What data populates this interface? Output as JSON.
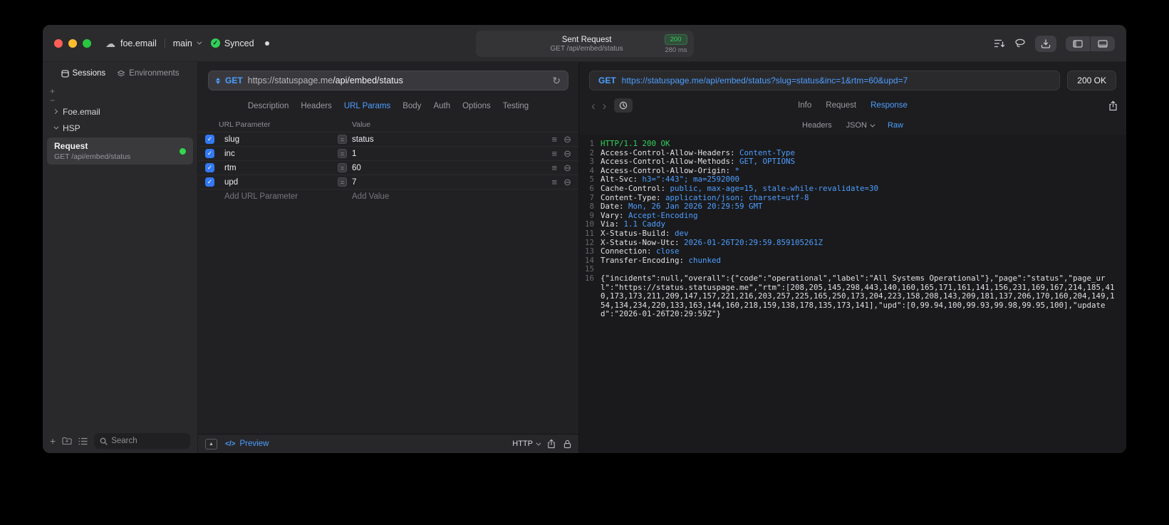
{
  "colors": {
    "accent_blue": "#4d9eff",
    "success_green": "#30d158",
    "checkbox_blue": "#3279f2"
  },
  "titlebar": {
    "project": "foe.email",
    "branch": "main",
    "synced": "Synced",
    "request_summary": {
      "title": "Sent Request",
      "status_code": "200",
      "method_path": "GET /api/embed/status",
      "duration": "280 ms"
    }
  },
  "sidebar": {
    "tabs": [
      {
        "label": "Sessions"
      },
      {
        "label": "Environments"
      }
    ],
    "groups": [
      {
        "label": "Foe.email"
      },
      {
        "label": "HSP"
      }
    ],
    "request_item": {
      "title": "Request",
      "subtitle": "GET /api/embed/status"
    },
    "search_placeholder": "Search"
  },
  "request_pane": {
    "method": "GET",
    "url_host": "https://statuspage.me",
    "url_path": "/api/embed/status",
    "tabs": [
      "Description",
      "Headers",
      "URL Params",
      "Body",
      "Auth",
      "Options",
      "Testing"
    ],
    "active_tab": "URL Params",
    "table": {
      "col_name": "URL Parameter",
      "col_value": "Value",
      "rows": [
        {
          "name": "slug",
          "value": "status",
          "enabled": true
        },
        {
          "name": "inc",
          "value": "1",
          "enabled": true
        },
        {
          "name": "rtm",
          "value": "60",
          "enabled": true
        },
        {
          "name": "upd",
          "value": "7",
          "enabled": true
        }
      ],
      "add_name": "Add URL Parameter",
      "add_value": "Add Value"
    },
    "footer": {
      "preview": "Preview",
      "protocol": "HTTP"
    }
  },
  "response_pane": {
    "method": "GET",
    "url": "https://statuspage.me/api/embed/status?slug=status&inc=1&rtm=60&upd=7",
    "status": "200 OK",
    "tabs": [
      "Info",
      "Request",
      "Response"
    ],
    "active_tab": "Response",
    "subtabs": [
      {
        "label": "Headers"
      },
      {
        "label": "JSON",
        "dropdown": true
      },
      {
        "label": "Raw"
      }
    ],
    "active_subtab": "Raw",
    "lines": [
      {
        "n": "1",
        "segs": [
          {
            "t": "HTTP/1.1 200 OK",
            "c": "g"
          }
        ]
      },
      {
        "n": "2",
        "segs": [
          {
            "t": "Access-Control-Allow-Headers: ",
            "c": "h"
          },
          {
            "t": "Content-Type",
            "c": "v"
          }
        ]
      },
      {
        "n": "3",
        "segs": [
          {
            "t": "Access-Control-Allow-Methods: ",
            "c": "h"
          },
          {
            "t": "GET, OPTIONS",
            "c": "v"
          }
        ]
      },
      {
        "n": "4",
        "segs": [
          {
            "t": "Access-Control-Allow-Origin: ",
            "c": "h"
          },
          {
            "t": "*",
            "c": "v"
          }
        ]
      },
      {
        "n": "5",
        "segs": [
          {
            "t": "Alt-Svc: ",
            "c": "h"
          },
          {
            "t": "h3=\":443\"; ma=2592000",
            "c": "v"
          }
        ]
      },
      {
        "n": "6",
        "segs": [
          {
            "t": "Cache-Control: ",
            "c": "h"
          },
          {
            "t": "public, max-age=15, stale-while-revalidate=30",
            "c": "v"
          }
        ]
      },
      {
        "n": "7",
        "segs": [
          {
            "t": "Content-Type: ",
            "c": "h"
          },
          {
            "t": "application/json; charset=utf-8",
            "c": "v"
          }
        ]
      },
      {
        "n": "8",
        "segs": [
          {
            "t": "Date: ",
            "c": "h"
          },
          {
            "t": "Mon, 26 Jan 2026 20:29:59 GMT",
            "c": "v"
          }
        ]
      },
      {
        "n": "9",
        "segs": [
          {
            "t": "Vary: ",
            "c": "h"
          },
          {
            "t": "Accept-Encoding",
            "c": "v"
          }
        ]
      },
      {
        "n": "10",
        "segs": [
          {
            "t": "Via: ",
            "c": "h"
          },
          {
            "t": "1.1 Caddy",
            "c": "v"
          }
        ]
      },
      {
        "n": "11",
        "segs": [
          {
            "t": "X-Status-Build: ",
            "c": "h"
          },
          {
            "t": "dev",
            "c": "v"
          }
        ]
      },
      {
        "n": "12",
        "segs": [
          {
            "t": "X-Status-Now-Utc: ",
            "c": "h"
          },
          {
            "t": "2026-01-26T20:29:59.859105261Z",
            "c": "v"
          }
        ]
      },
      {
        "n": "13",
        "segs": [
          {
            "t": "Connection: ",
            "c": "h"
          },
          {
            "t": "close",
            "c": "v"
          }
        ]
      },
      {
        "n": "14",
        "segs": [
          {
            "t": "Transfer-Encoding: ",
            "c": "h"
          },
          {
            "t": "chunked",
            "c": "v"
          }
        ]
      },
      {
        "n": "15",
        "segs": []
      },
      {
        "n": "16",
        "segs": [
          {
            "t": "{\"incidents\":null,\"overall\":{\"code\":\"operational\",\"label\":\"All Systems Operational\"},\"page\":\"status\",\"page_url\":\"https://status.statuspage.me\",\"rtm\":[208,205,145,298,443,140,160,165,171,161,141,156,231,169,167,214,185,410,173,173,211,209,147,157,221,216,203,257,225,165,250,173,204,223,158,208,143,209,181,137,206,170,160,204,149,154,134,234,220,133,163,144,160,218,159,138,178,135,173,141],\"upd\":[0,99.94,100,99.93,99.98,99.95,100],\"updated\":\"2026-01-26T20:29:59Z\"}",
            "c": "p"
          }
        ]
      }
    ]
  }
}
